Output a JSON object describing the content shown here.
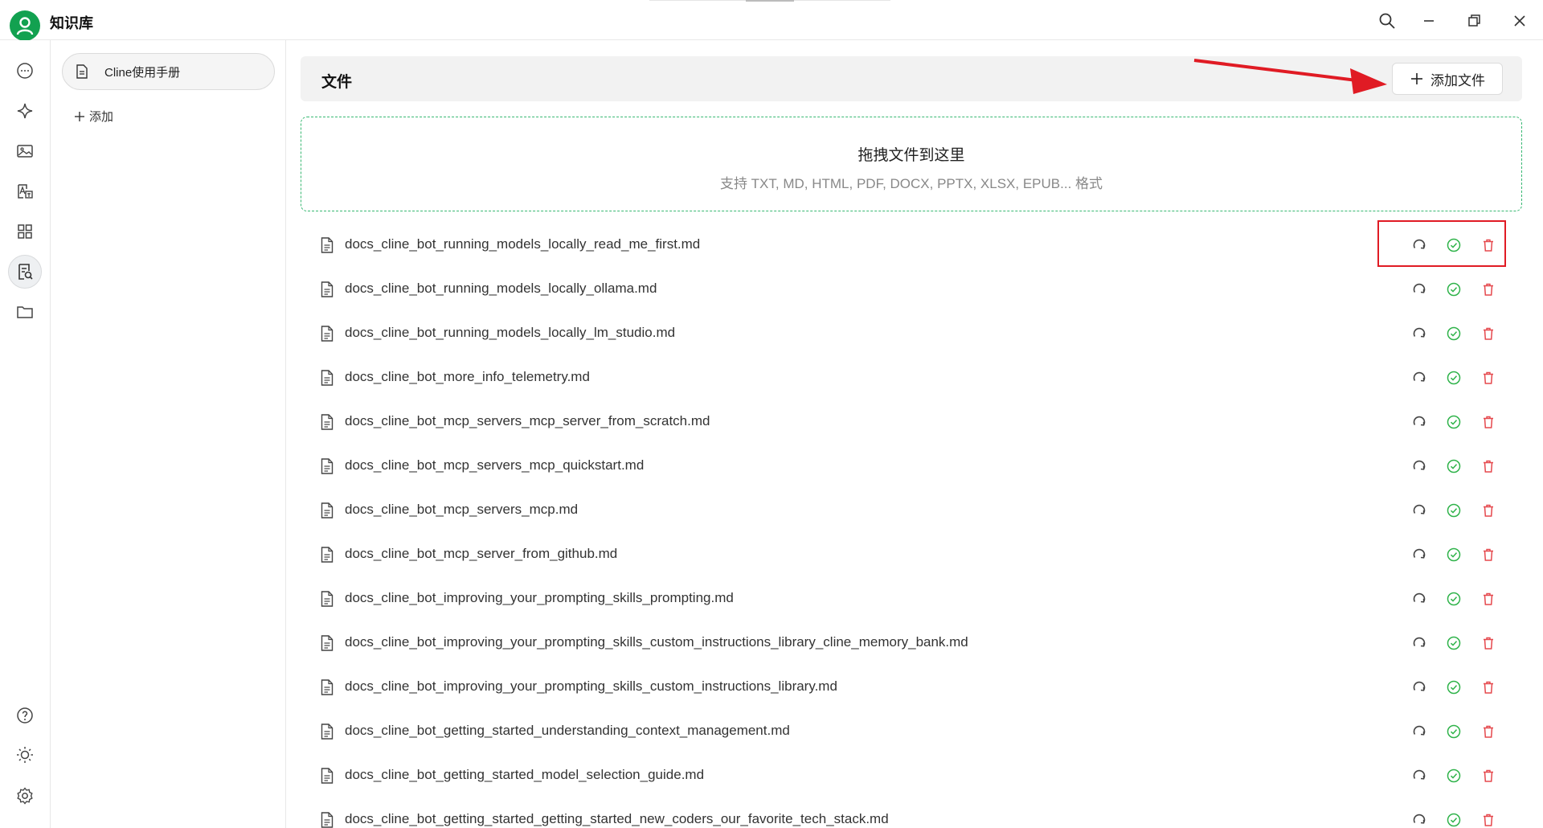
{
  "app": {
    "title": "知识库"
  },
  "rail": {
    "items": [
      {
        "name": "chat-icon"
      },
      {
        "name": "sparkle-icon"
      },
      {
        "name": "image-icon"
      },
      {
        "name": "translate-icon"
      },
      {
        "name": "apps-grid-icon"
      },
      {
        "name": "knowledge-base-icon",
        "active": true
      },
      {
        "name": "folder-icon"
      },
      {
        "name": "help-icon"
      },
      {
        "name": "theme-sun-icon"
      },
      {
        "name": "settings-gear-icon"
      }
    ]
  },
  "kb_panel": {
    "items": [
      {
        "label": "Cline使用手册"
      }
    ],
    "add_label": "添加"
  },
  "main": {
    "header_title": "文件",
    "add_file_label": "添加文件",
    "dropzone": {
      "title": "拖拽文件到这里",
      "subtitle": "支持 TXT, MD, HTML, PDF, DOCX, PPTX, XLSX, EPUB... 格式"
    },
    "files": [
      "docs_cline_bot_running_models_locally_read_me_first.md",
      "docs_cline_bot_running_models_locally_ollama.md",
      "docs_cline_bot_running_models_locally_lm_studio.md",
      "docs_cline_bot_more_info_telemetry.md",
      "docs_cline_bot_mcp_servers_mcp_server_from_scratch.md",
      "docs_cline_bot_mcp_servers_mcp_quickstart.md",
      "docs_cline_bot_mcp_servers_mcp.md",
      "docs_cline_bot_mcp_server_from_github.md",
      "docs_cline_bot_improving_your_prompting_skills_prompting.md",
      "docs_cline_bot_improving_your_prompting_skills_custom_instructions_library_cline_memory_bank.md",
      "docs_cline_bot_improving_your_prompting_skills_custom_instructions_library.md",
      "docs_cline_bot_getting_started_understanding_context_management.md",
      "docs_cline_bot_getting_started_model_selection_guide.md",
      "docs_cline_bot_getting_started_getting_started_new_coders_our_favorite_tech_stack.md"
    ]
  },
  "colors": {
    "brand_green": "#12a150",
    "success_green": "#2fb34a",
    "delete_red": "#e5484d",
    "annotation_red": "#e01b24"
  }
}
